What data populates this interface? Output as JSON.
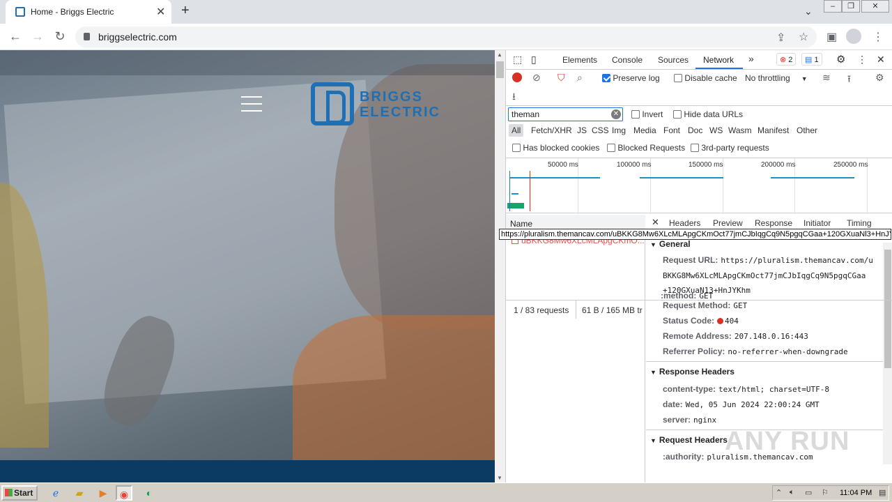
{
  "browser": {
    "tab_title": "Home - Briggs Electric",
    "tab_close": "✕",
    "new_tab": "+",
    "url": "briggselectric.com"
  },
  "page": {
    "logo_line1": "BRIGGS",
    "logo_line2": "ELECTRIC"
  },
  "devtools": {
    "tabs": [
      "Elements",
      "Console",
      "Sources",
      "Network"
    ],
    "more_tabs": "»",
    "error_count": "2",
    "message_count": "1",
    "toolbar": {
      "preserve_log": "Preserve log",
      "disable_cache": "Disable cache",
      "throttling": "No throttling"
    },
    "filter": {
      "value": "theman",
      "invert": "Invert",
      "hide_data_urls": "Hide data URLs"
    },
    "types": [
      "All",
      "Fetch/XHR",
      "JS",
      "CSS",
      "Img",
      "Media",
      "Font",
      "Doc",
      "WS",
      "Wasm",
      "Manifest",
      "Other"
    ],
    "checks": {
      "blocked_cookies": "Has blocked cookies",
      "blocked_requests": "Blocked Requests",
      "third_party": "3rd-party requests"
    },
    "overview_labels": [
      "50000 ms",
      "100000 ms",
      "150000 ms",
      "200000 ms",
      "250000 ms"
    ],
    "table": {
      "name_header": "Name",
      "row_name": "uBKKG8Mw6XLcMLApgCKmO..."
    },
    "tooltip": "https://pluralism.themancav.com/uBKKG8Mw6XLcMLApgCKmOct77jmCJbIqgCq9N5pgqCGaa+120GXuaNl3+HnJYKhm",
    "detail_tabs": [
      "Headers",
      "Preview",
      "Response",
      "Initiator",
      "Timing"
    ],
    "general": {
      "title": "General",
      "request_url_label": "Request URL:",
      "request_url_line1": "https://pluralism.themancav.com/u",
      "request_url_line2": "BKKG8Mw6XLcMLApgCKmOct77jmCJbIqgCq9N5pgqCGaa",
      "request_url_line3": "+120GXuaN13+HnJYKhm",
      "method_label": "Request Method:",
      "method": "GET",
      "status_label": "Status Code:",
      "status": "404",
      "remote_label": "Remote Address:",
      "remote": "207.148.0.16:443",
      "referrer_label": "Referrer Policy:",
      "referrer": "no-referrer-when-downgrade"
    },
    "response_headers": {
      "title": "Response Headers",
      "ct_label": "content-type:",
      "ct": "text/html; charset=UTF-8",
      "date_label": "date:",
      "date": "Wed, 05 Jun 2024 22:00:24 GMT",
      "server_label": "server:",
      "server": "nginx"
    },
    "request_headers": {
      "title": "Request Headers",
      "authority_label": ":authority:",
      "authority": "pluralism.themancav.com",
      "method_label": ":method:",
      "method": "GET"
    },
    "status_bar": {
      "requests": "1 / 83 requests",
      "transferred": "61 B / 165 MB tr"
    }
  },
  "taskbar": {
    "start": "Start",
    "clock": "11:04 PM"
  },
  "watermark": "ANY RUN"
}
